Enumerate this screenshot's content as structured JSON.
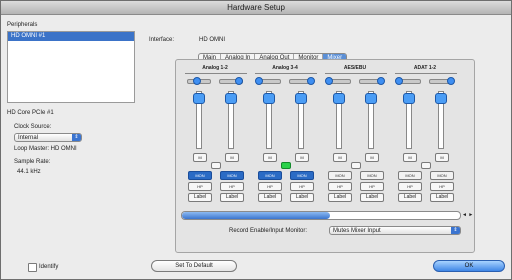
{
  "window": {
    "title": "Hardware Setup"
  },
  "peripherals": {
    "label": "Peripherals",
    "items": [
      "HD OMNI #1"
    ]
  },
  "interface": {
    "label": "Interface:",
    "value": "HD OMNI"
  },
  "tabs": [
    "Main",
    "Analog In",
    "Analog Out",
    "Monitor",
    "Mixer"
  ],
  "active_tab": "Mixer",
  "device": "HD Core PCIe #1",
  "clock": {
    "label": "Clock Source:",
    "value": "Internal",
    "loop_master": "Loop Master: HD OMNI"
  },
  "sample_rate": {
    "label": "Sample Rate:",
    "value": "44.1 kHz"
  },
  "mixer": {
    "groups": [
      {
        "name": "Analog 1-2",
        "mon_on": true,
        "link_on": false
      },
      {
        "name": "Analog 3-4",
        "mon_on": true,
        "link_on": true
      },
      {
        "name": "AES/EBU",
        "mon_on": false,
        "link_on": false
      },
      {
        "name": "ADAT 1-2",
        "mon_on": false,
        "link_on": false
      }
    ],
    "m_label": "M",
    "mon_label": "MON",
    "hp_label": "HP",
    "label_btn": "Label",
    "scroll_arrows": "◄ ►"
  },
  "record_monitor": {
    "label": "Record Enable/Input Monitor:",
    "value": "Mutes Mixer Input"
  },
  "identify": "Identify",
  "set_default": "Set To Default",
  "ok": "OK"
}
